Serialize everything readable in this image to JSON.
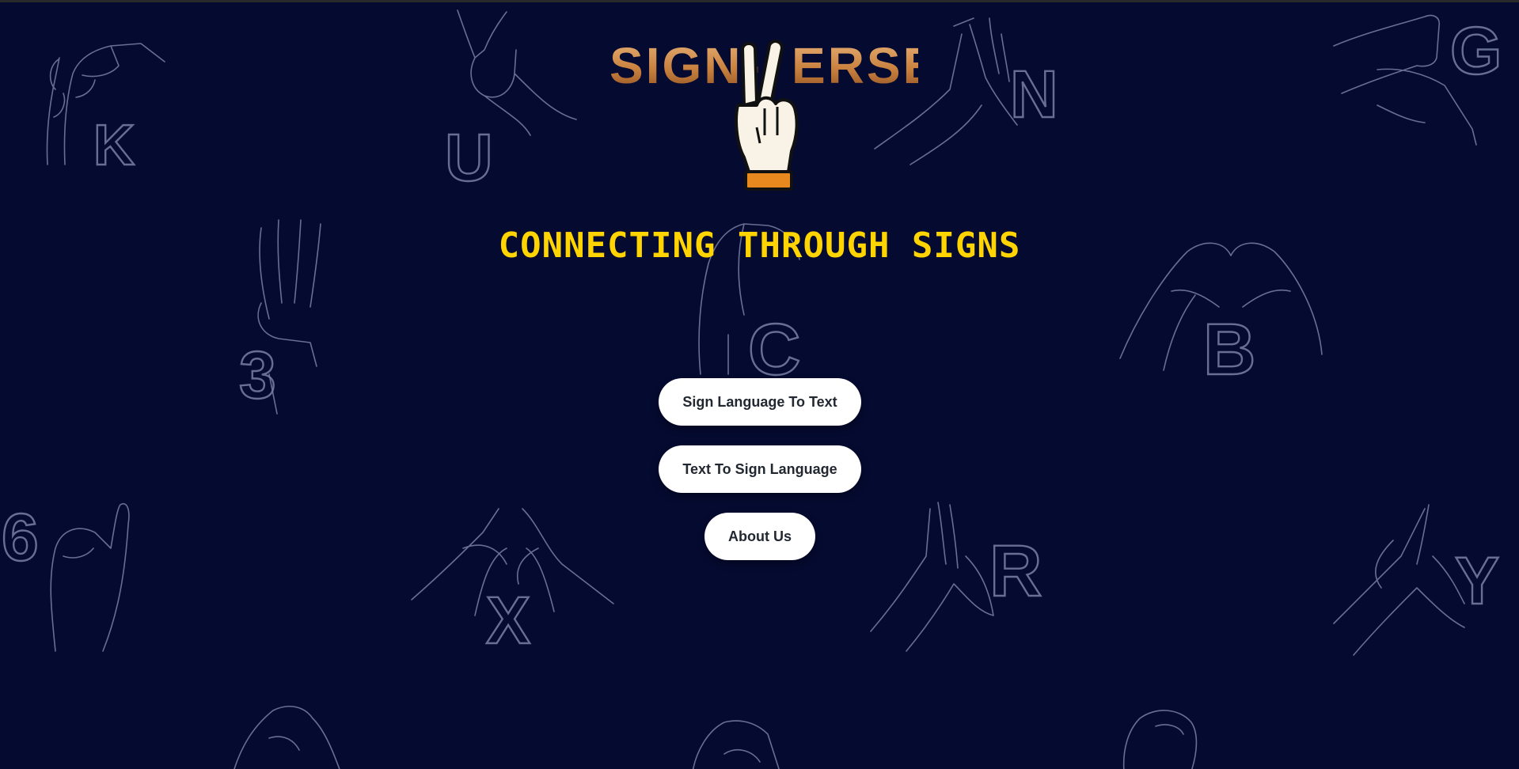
{
  "logo": {
    "left_text": "SIGN-",
    "right_text": "ERSE",
    "hand_icon": "peace-sign-hand-icon"
  },
  "hero": {
    "tagline": "CONNECTING THROUGH SIGNS"
  },
  "menu": {
    "sign_to_text_label": "Sign Language To Text",
    "text_to_sign_label": "Text To Sign Language",
    "about_label": "About Us"
  },
  "background": {
    "letters": [
      "K",
      "U",
      "N",
      "G",
      "3",
      "C",
      "B",
      "6",
      "X",
      "R",
      "Y"
    ]
  },
  "colors": {
    "background": "#050a30",
    "accent": "#ffd400",
    "logo_gradient_start": "#c9823f",
    "logo_gradient_end": "#e8b27a",
    "button_bg": "#ffffff",
    "button_text": "#222831",
    "line_art": "#7a81a6"
  }
}
